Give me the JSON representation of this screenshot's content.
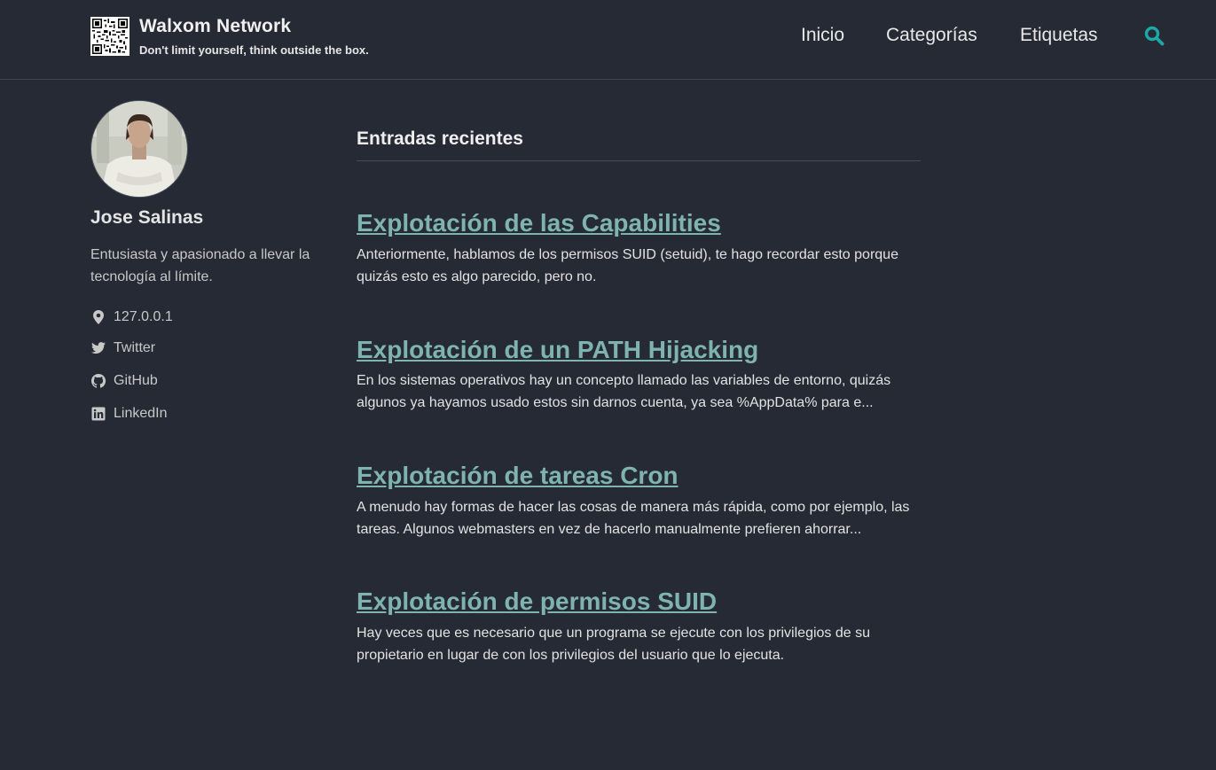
{
  "header": {
    "site_title": "Walxom Network",
    "site_subtitle": "Don't limit yourself, think outside the box.",
    "nav": [
      "Inicio",
      "Categorías",
      "Etiquetas"
    ],
    "search_icon": "search-icon"
  },
  "author": {
    "name": "Jose Salinas",
    "bio": "Entusiasta y apasionado a llevar la tecnología al límite.",
    "location": "127.0.0.1",
    "links": {
      "twitter": "Twitter",
      "github": "GitHub",
      "linkedin": "LinkedIn"
    }
  },
  "main": {
    "section_title": "Entradas recientes",
    "posts": [
      {
        "title": "Explotación de las Capabilities",
        "excerpt": "Anteriormente, hablamos de los permisos SUID (setuid), te hago recordar esto porque quizás esto es algo parecido, pero no."
      },
      {
        "title": "Explotación de un PATH Hijacking",
        "excerpt": "En los sistemas operativos hay un concepto llamado las variables de entorno, quizás algunos ya hayamos usado estos sin darnos cuenta, ya sea %AppData% para e..."
      },
      {
        "title": "Explotación de tareas Cron",
        "excerpt": "A menudo hay formas de hacer las cosas de manera más rápida, como por ejemplo, las tareas. Algunos webmasters en vez de hacerlo manualmente prefieren ahorrar..."
      },
      {
        "title": "Explotación de permisos SUID",
        "excerpt": "Hay veces que es necesario que un programa se ejecute con los privilegios de su propietario en lugar de con los privilegios del usuario que lo ejecuta."
      }
    ]
  },
  "colors": {
    "background": "#252a34",
    "link": "#7fb3b0",
    "accent": "#1fa6a6"
  }
}
